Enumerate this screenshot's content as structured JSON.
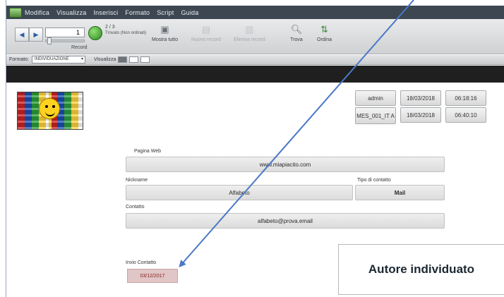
{
  "menu": {
    "items": [
      "Modifica",
      "Visualizza",
      "Inserisci",
      "Formato",
      "Script",
      "Guida"
    ]
  },
  "toolbar": {
    "record_value": "1",
    "record_total": "2 / 3",
    "record_status": "Trovato (Non ordinati)",
    "records_label": "Record",
    "show_all_label": "Mostra tutto",
    "new_record_label": "Nuovo record",
    "delete_record_label": "Elimina record",
    "find_label": "Trova",
    "sort_label": "Ordina"
  },
  "layout_bar": {
    "layout_label": "Formato:",
    "layout_value": "INDIVIDUAZIONE",
    "view_label": "Visualizza"
  },
  "meta": {
    "user_1": "admin",
    "date_1": "18/03/2018",
    "time_1": "06:18:16",
    "user_2": "MES_001_IT A",
    "date_2": "18/03/2018",
    "time_2": "06:40:10"
  },
  "form": {
    "web_label": "Pagina Web",
    "web_value": "www.miapiacito.com",
    "nickname_label": "Nickname",
    "nickname_value": "Alfabeto",
    "contact_type_label": "Tipo di contatto",
    "contact_type_value": "Mail",
    "contact_label": "Contatto",
    "contact_value": "alfabeto@prova.email",
    "invite_label": "Invio Contatto",
    "invite_value": "03/12/2017"
  },
  "author_box": "Autore individuato",
  "colors": {
    "menubar": "#3d4752",
    "header_band": "#1f1f1f",
    "annotation_arrow": "#4a78c6",
    "date_field": "#e0c6c6"
  },
  "icons": [
    "app-icon",
    "back-arrow-icon",
    "forward-arrow-icon",
    "pie-chart-icon",
    "show-all-icon",
    "new-record-icon",
    "delete-record-icon",
    "search-icon",
    "sort-icon"
  ]
}
